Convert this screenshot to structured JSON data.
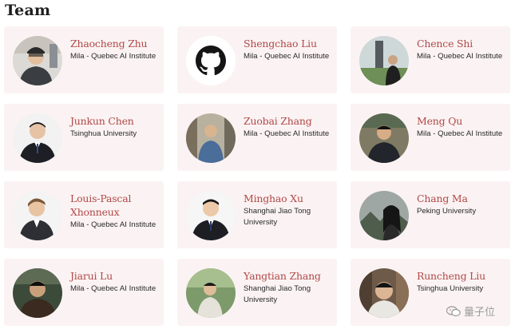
{
  "page": {
    "title": "Team"
  },
  "members": [
    {
      "name": "Zhaocheng Zhu",
      "affiliation": "Mila - Quebec AI Institute",
      "avatar": "person-photo"
    },
    {
      "name": "Shengchao Liu",
      "affiliation": "Mila - Quebec AI Institute",
      "avatar": "github-icon"
    },
    {
      "name": "Chence Shi",
      "affiliation": "Mila - Quebec AI Institute",
      "avatar": "person-photo"
    },
    {
      "name": "Junkun Chen",
      "affiliation": "Tsinghua University",
      "avatar": "person-photo"
    },
    {
      "name": "Zuobai Zhang",
      "affiliation": "Mila - Quebec AI Institute",
      "avatar": "person-photo"
    },
    {
      "name": "Meng Qu",
      "affiliation": "Mila - Quebec AI Institute",
      "avatar": "person-photo"
    },
    {
      "name": "Louis-Pascal Xhonneux",
      "affiliation": "Mila - Quebec AI Institute",
      "avatar": "person-photo"
    },
    {
      "name": "Minghao Xu",
      "affiliation": "Shanghai Jiao Tong University",
      "avatar": "person-photo"
    },
    {
      "name": "Chang Ma",
      "affiliation": "Peking University",
      "avatar": "person-photo"
    },
    {
      "name": "Jiarui Lu",
      "affiliation": "Mila - Quebec AI Institute",
      "avatar": "person-photo"
    },
    {
      "name": "Yangtian Zhang",
      "affiliation": "Shanghai Jiao Tong University",
      "avatar": "person-photo"
    },
    {
      "name": "Runcheng Liu",
      "affiliation": "Tsinghua University",
      "avatar": "person-photo"
    }
  ],
  "watermark": {
    "text": "量子位",
    "icon": "wechat-icon"
  },
  "colors": {
    "name": "#b14848",
    "card_bg": "#fbf3f3",
    "title": "#1f1f1f"
  }
}
